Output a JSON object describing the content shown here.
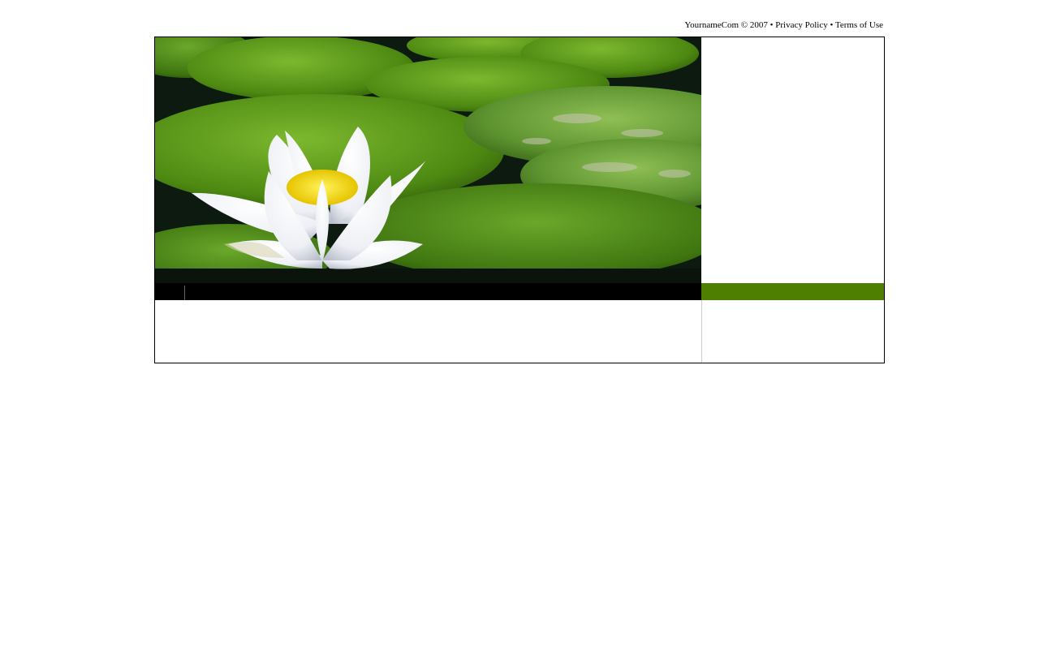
{
  "footer_links": {
    "copyright": "YournameCom © 2007",
    "separator": " • ",
    "privacy_label": "Privacy Policy",
    "terms_label": "Terms of Use"
  },
  "hero": {
    "image_name": "water-lily-photo"
  },
  "colors": {
    "accent": "#4f7f00",
    "nav_background": "#000000",
    "border": "#000000",
    "page_background": "#ffffff"
  }
}
